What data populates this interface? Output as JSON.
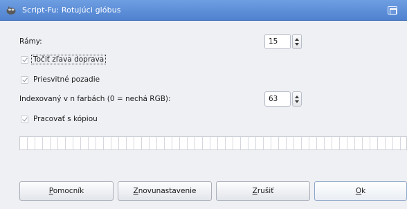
{
  "window": {
    "title": "Script-Fu: Rotujúci glóbus"
  },
  "fields": {
    "frames_label": "Rámy:",
    "frames_value": "15",
    "indexed_label": "Indexovaný v n farbách (0 = nechá RGB):",
    "indexed_value": "63"
  },
  "checks": {
    "rotate": "Točiť zľava doprava",
    "transparent": "Priesvitné pozadie",
    "copy": "Pracovať s kópiou"
  },
  "progress": {
    "value": 0
  },
  "buttons": {
    "help_first": "P",
    "help_rest": "omocník",
    "reset_first": "Z",
    "reset_rest": "novunastavenie",
    "cancel_first": "Z",
    "cancel_rest": "rušiť",
    "ok_first": "O",
    "ok_rest": "k"
  }
}
